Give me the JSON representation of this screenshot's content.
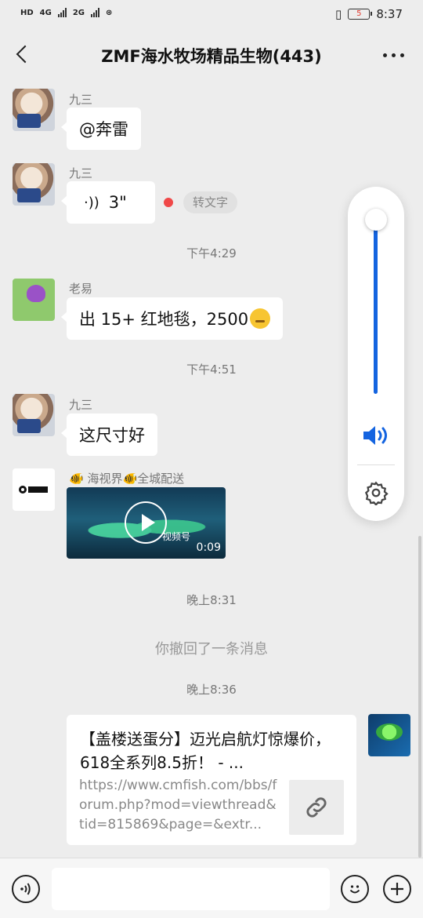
{
  "status_bar": {
    "left_labels": [
      "HD",
      "4G",
      "2G"
    ],
    "battery": "5",
    "time": "8:37"
  },
  "header": {
    "title": "ZMF海水牧场精品生物(443)"
  },
  "messages": [
    {
      "type": "text",
      "sender": "九三",
      "text": "@奔雷"
    },
    {
      "type": "voice",
      "sender": "九三",
      "duration": "3\"",
      "action": "转文字"
    },
    {
      "type": "time",
      "text": "下午4:29"
    },
    {
      "type": "text",
      "sender": "老易",
      "text": "出 15+ 红地毯，2500"
    },
    {
      "type": "time",
      "text": "下午4:51"
    },
    {
      "type": "text",
      "sender": "九三",
      "text": "这尺寸好"
    },
    {
      "type": "video",
      "sender": "🐠 海视界🐠全城配送",
      "duration": "0:09",
      "watermark": "视频号"
    },
    {
      "type": "time",
      "text": "晚上8:31"
    },
    {
      "type": "system",
      "text": "你撤回了一条消息"
    },
    {
      "type": "time",
      "text": "晚上8:36"
    },
    {
      "type": "link",
      "title": "【盖楼送蛋分】迈光启航灯惊爆价，618全系列8.5折！ - ...",
      "url": "https://www.cmfish.com/bbs/forum.php?mod=viewthread&tid=815869&page=&extr..."
    }
  ],
  "volume": {
    "level": 1.0
  },
  "colors": {
    "accent": "#1464e0",
    "background": "#ededed",
    "red_dot": "#f04848"
  }
}
